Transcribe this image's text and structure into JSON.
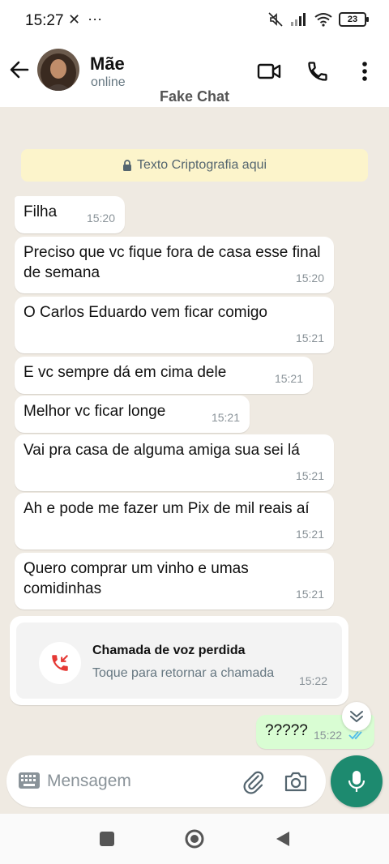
{
  "status_bar": {
    "time": "15:27",
    "left_icons": "✕ ⋯",
    "battery": "23"
  },
  "header": {
    "contact_name": "Mãe",
    "contact_status": "online",
    "caption": "Fake Chat"
  },
  "encryption_banner": "Texto Criptografia aqui",
  "messages": [
    {
      "text": "Filha",
      "time": "15:20"
    },
    {
      "text": "Preciso que vc fique fora de casa esse final de semana",
      "time": "15:20"
    },
    {
      "text": "O Carlos Eduardo vem ficar comigo",
      "time": "15:21"
    },
    {
      "text": "E vc sempre dá em cima dele",
      "time": "15:21"
    },
    {
      "text": "Melhor vc ficar longe",
      "time": "15:21"
    },
    {
      "text": "Vai pra casa de alguma amiga sua sei lá",
      "time": "15:21"
    },
    {
      "text": "Ah e pode me fazer um Pix de mil reais aí",
      "time": "15:21"
    },
    {
      "text": "Quero comprar um vinho e umas comidinhas",
      "time": "15:21"
    }
  ],
  "missed_call": {
    "title": "Chamada de voz perdida",
    "subtitle": "Toque para retornar a chamada",
    "time": "15:22"
  },
  "outgoing": {
    "text": "?????",
    "time": "15:22"
  },
  "input": {
    "placeholder": "Mensagem"
  },
  "colors": {
    "accent": "#1d8a6f",
    "chat_bg": "#efeae2",
    "outgoing_bubble": "#d9fdd3",
    "banner_bg": "#fcf4cb",
    "missed_call_red": "#e53935",
    "read_ticks": "#53bdeb"
  },
  "icons": [
    "back-arrow-icon",
    "video-call-icon",
    "phone-icon",
    "more-vert-icon",
    "lock-icon",
    "missed-call-icon",
    "double-chevron-down-icon",
    "keyboard-icon",
    "paperclip-icon",
    "camera-icon",
    "mic-icon",
    "double-check-icon"
  ]
}
